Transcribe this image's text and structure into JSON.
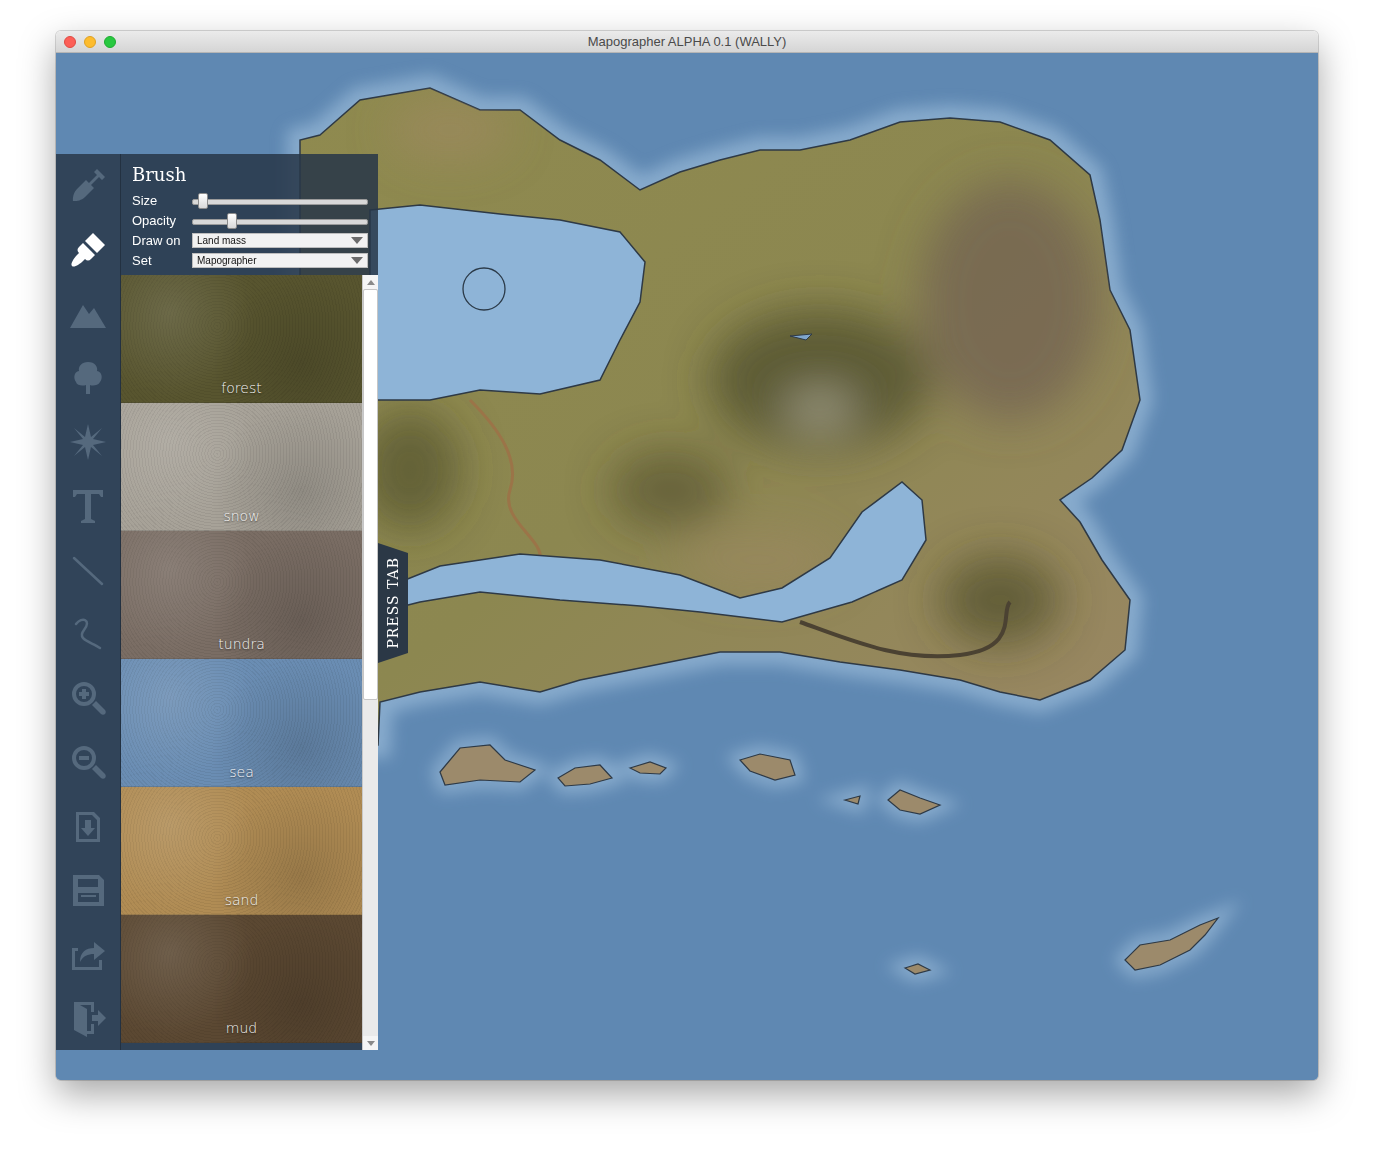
{
  "window": {
    "title": "Mapographer ALPHA 0.1 (WALLY)"
  },
  "toolbar": {
    "tools": [
      {
        "kind": "shovel",
        "selected": false
      },
      {
        "kind": "brush",
        "selected": true
      },
      {
        "kind": "mountain",
        "selected": false
      },
      {
        "kind": "tree",
        "selected": false
      },
      {
        "kind": "compass",
        "selected": false
      },
      {
        "kind": "text",
        "selected": false
      },
      {
        "kind": "line",
        "selected": false
      },
      {
        "kind": "curve",
        "selected": false
      },
      {
        "kind": "zoomin",
        "selected": false
      },
      {
        "kind": "zoomout",
        "selected": false
      },
      {
        "kind": "import",
        "selected": false
      },
      {
        "kind": "save",
        "selected": false
      },
      {
        "kind": "export",
        "selected": false
      },
      {
        "kind": "exit",
        "selected": false
      }
    ]
  },
  "panel": {
    "title": "Brush",
    "sliders": [
      {
        "label": "Size",
        "level": 0.06
      },
      {
        "label": "Opacity",
        "level": 0.23
      }
    ],
    "dropdowns": [
      {
        "label": "Draw on",
        "value": "Land mass"
      },
      {
        "label": "Set",
        "value": "Mapographer"
      }
    ],
    "textures": [
      {
        "name": "forest",
        "color": "#58552f"
      },
      {
        "name": "snow",
        "color": "#a7a298"
      },
      {
        "name": "tundra",
        "color": "#7a6d64"
      },
      {
        "name": "sea",
        "color": "#6a8db3"
      },
      {
        "name": "sand",
        "color": "#b08c54"
      },
      {
        "name": "mud",
        "color": "#5b4832"
      }
    ],
    "scroll": {
      "level": 0.55
    }
  },
  "press_tab": {
    "label": "PRESS TAB"
  }
}
